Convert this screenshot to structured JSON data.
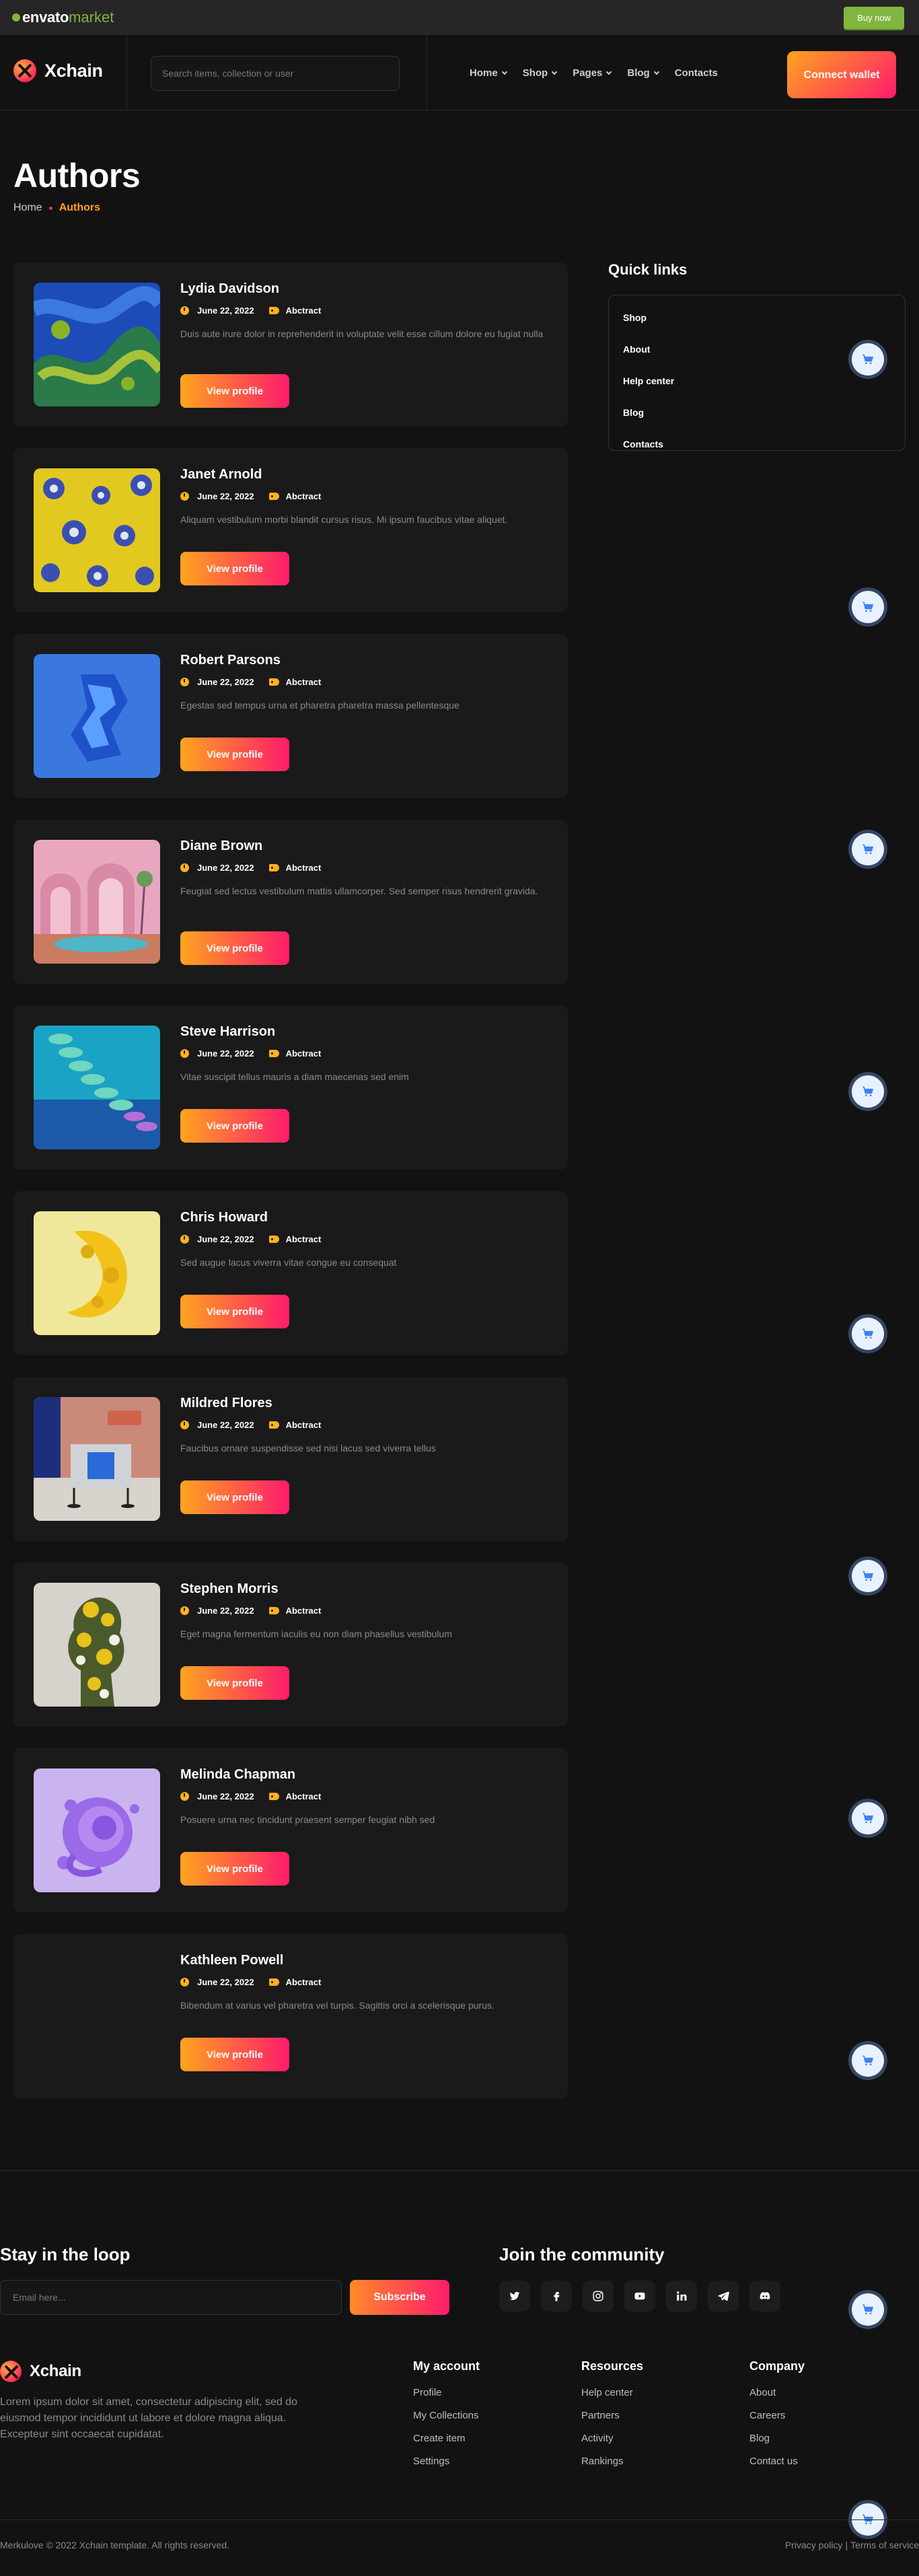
{
  "envato": {
    "logo_bold": "envato",
    "logo_light": "market",
    "buy_label": "Buy now"
  },
  "header": {
    "brand": "Xchain",
    "search_placeholder": "Search items, collection or user",
    "nav": [
      "Home",
      "Shop",
      "Pages",
      "Blog",
      "Contacts"
    ],
    "connect_label": "Connect wallet"
  },
  "page": {
    "title": "Authors",
    "breadcrumb": {
      "home": "Home",
      "current": "Authors"
    }
  },
  "authors": [
    {
      "name": "Lydia Davidson",
      "date": "June 22, 2022",
      "tag": "Abctract",
      "desc": "Duis aute irure dolor in reprehenderit in voluptate velit esse cillum dolore eu fugiat nulla",
      "button": "View profile"
    },
    {
      "name": "Janet Arnold",
      "date": "June 22, 2022",
      "tag": "Abctract",
      "desc": "Aliquam vestibulum morbi blandit cursus risus. Mi ipsum faucibus vitae aliquet.",
      "button": "View profile"
    },
    {
      "name": "Robert Parsons",
      "date": "June 22, 2022",
      "tag": "Abctract",
      "desc": "Egestas sed tempus urna et pharetra pharetra massa pellentesque",
      "button": "View profile"
    },
    {
      "name": "Diane Brown",
      "date": "June 22, 2022",
      "tag": "Abctract",
      "desc": "Feugiat sed lectus vestibulum mattis ullamcorper. Sed semper risus hendrerit gravida.",
      "button": "View profile"
    },
    {
      "name": "Steve Harrison",
      "date": "June 22, 2022",
      "tag": "Abctract",
      "desc": "Vitae suscipit tellus mauris a diam maecenas sed enim",
      "button": "View profile"
    },
    {
      "name": "Chris Howard",
      "date": "June 22, 2022",
      "tag": "Abctract",
      "desc": "Sed augue lacus viverra vitae congue eu consequat",
      "button": "View profile"
    },
    {
      "name": "Mildred Flores",
      "date": "June 22, 2022",
      "tag": "Abctract",
      "desc": "Faucibus ornare suspendisse sed nisi lacus sed viverra tellus",
      "button": "View profile"
    },
    {
      "name": "Stephen Morris",
      "date": "June 22, 2022",
      "tag": "Abctract",
      "desc": "Eget magna fermentum iaculis eu non diam phasellus vestibulum",
      "button": "View profile"
    },
    {
      "name": "Melinda Chapman",
      "date": "June 22, 2022",
      "tag": "Abctract",
      "desc": "Posuere urna nec tincidunt praesent semper feugiat nibh sed",
      "button": "View profile"
    },
    {
      "name": "Kathleen Powell",
      "date": "June 22, 2022",
      "tag": "Abctract",
      "desc": "Bibendum at varius vel pharetra vel turpis. Sagittis orci a scelerisque purus.",
      "button": "View profile"
    }
  ],
  "quick_links": {
    "title": "Quick links",
    "items": [
      "Shop",
      "About",
      "Help center",
      "Blog",
      "Contacts"
    ]
  },
  "footer": {
    "stay_title": "Stay in the loop",
    "email_placeholder": "Email here...",
    "subscribe_label": "Subscribe",
    "join_title": "Join the community",
    "socials": [
      "twitter-icon",
      "facebook-icon",
      "instagram-icon",
      "youtube-icon",
      "linkedin-icon",
      "telegram-icon",
      "discord-icon"
    ],
    "brand": "Xchain",
    "about": "Lorem ipsum dolor sit amet, consectetur adipiscing elit, sed do eiusmod tempor incididunt ut labore et dolore magna aliqua. Excepteur sint occaecat cupidatat.",
    "columns": [
      {
        "title": "My account",
        "links": [
          "Profile",
          "My Collections",
          "Create item",
          "Settings"
        ]
      },
      {
        "title": "Resources",
        "links": [
          "Help center",
          "Partners",
          "Activity",
          "Rankings"
        ]
      },
      {
        "title": "Company",
        "links": [
          "About",
          "Careers",
          "Blog",
          "Contact us"
        ]
      }
    ],
    "copyright": "Merkulove © 2022 Xchain template. All rights reserved.",
    "privacy": "Privacy policy",
    "separator": "|",
    "terms": "Terms of service"
  },
  "colors": {
    "accent_start": "#ffa51e",
    "accent_end": "#ff1b6b",
    "envato_green": "#82b440",
    "background": "#121212",
    "card": "#1a1a1a"
  }
}
